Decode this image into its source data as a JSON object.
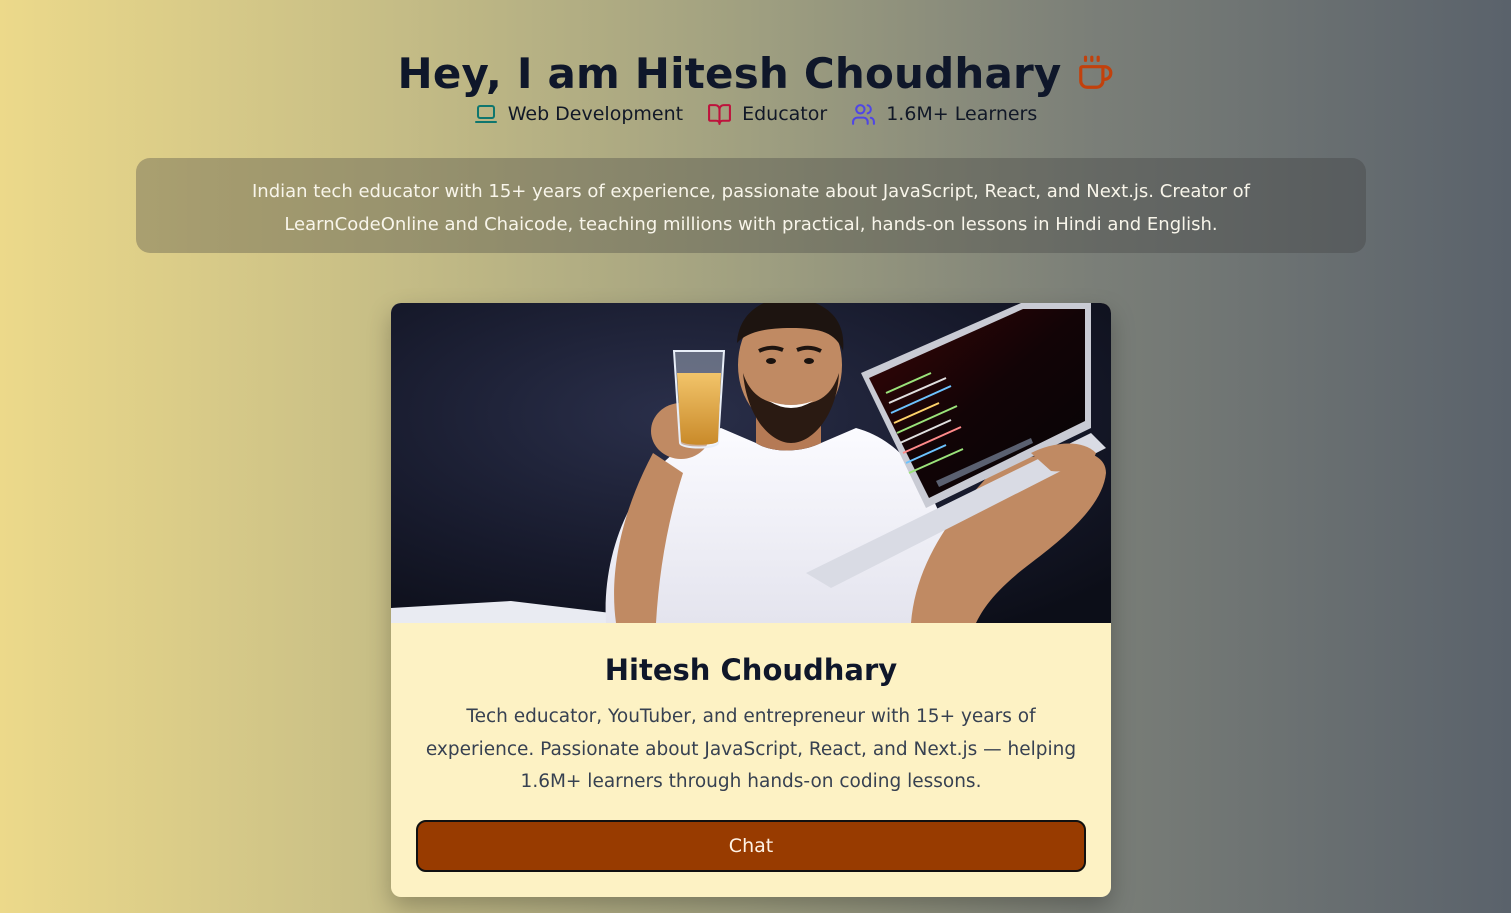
{
  "header": {
    "title": "Hey, I am Hitesh Choudhary",
    "title_icon": "coffee-cup-icon",
    "title_icon_color": "#c2410c"
  },
  "tags": [
    {
      "label": "Web Development",
      "icon": "laptop-icon",
      "icon_color": "#0f766e"
    },
    {
      "label": "Educator",
      "icon": "book-open-icon",
      "icon_color": "#be123c"
    },
    {
      "label": "1.6M+ Learners",
      "icon": "users-icon",
      "icon_color": "#4f46e5"
    }
  ],
  "intro": {
    "text": "Indian tech educator with 15+ years of experience, passionate about JavaScript, React, and Next.js. Creator of LearnCodeOnline and Chaicode, teaching millions with practical, hands-on lessons in Hindi and English."
  },
  "card": {
    "photo_subject": "person-holding-glass-and-laptop",
    "name": "Hitesh Choudhary",
    "bio": "Tech educator, YouTuber, and entrepreneur with 15+ years of experience. Passionate about JavaScript, React, and Next.js — helping 1.6M+ learners through hands-on coding lessons.",
    "button_label": "Chat",
    "button_color": "#983b00"
  }
}
